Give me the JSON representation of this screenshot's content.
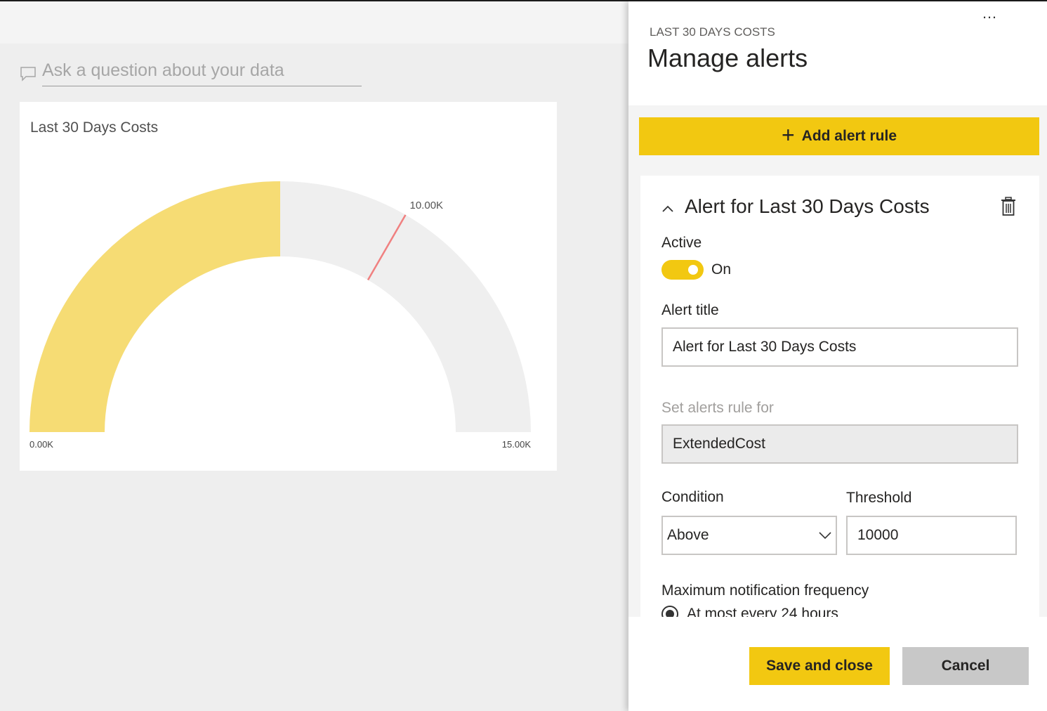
{
  "qna": {
    "placeholder": "Ask a question about your data"
  },
  "tile": {
    "title": "Last 30 Days Costs"
  },
  "chart_data": {
    "type": "gauge",
    "title": "Last 30 Days Costs",
    "min": 0,
    "max": 15000,
    "value": 7500,
    "target": 10000,
    "min_label": "0.00K",
    "max_label": "15.00K",
    "target_label": "10.00K",
    "colors": {
      "fill": "#f6dc74",
      "track": "#efefef",
      "target": "#f08080"
    }
  },
  "panel": {
    "more": "…",
    "subtitle": "LAST 30 DAYS COSTS",
    "title": "Manage alerts",
    "add_rule": "Add alert rule",
    "alert": {
      "title": "Alert for Last 30 Days Costs",
      "active_label": "Active",
      "toggle_state": "On",
      "alert_title_label": "Alert title",
      "alert_title_value": "Alert for Last 30 Days Costs",
      "rule_for_label": "Set alerts rule for",
      "rule_for_value": "ExtendedCost",
      "condition_label": "Condition",
      "condition_value": "Above",
      "threshold_label": "Threshold",
      "threshold_value": "10000",
      "frequency_label": "Maximum notification frequency",
      "frequency_option": "At most every 24 hours"
    },
    "save": "Save and close",
    "cancel": "Cancel"
  },
  "colors": {
    "accent": "#f2c811"
  }
}
